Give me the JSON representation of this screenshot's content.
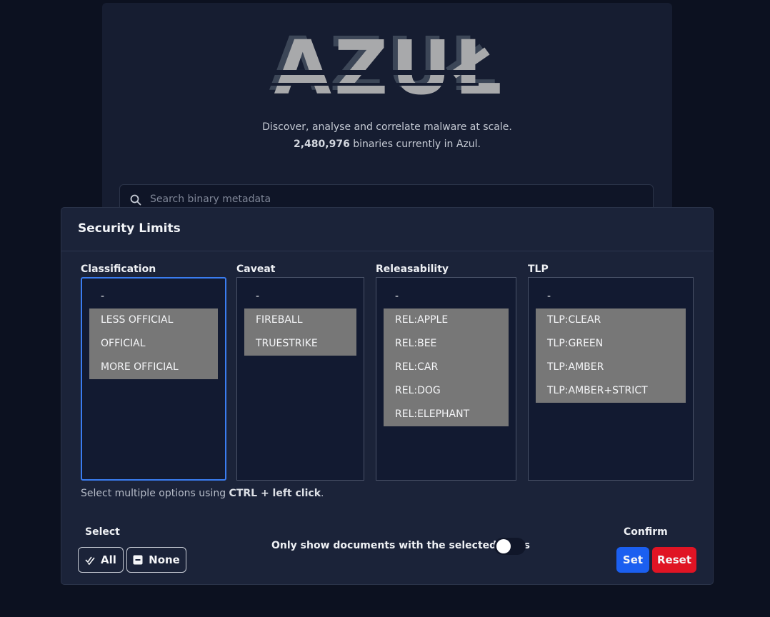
{
  "app": {
    "logo_text": "AZUŁ",
    "tagline": "Discover, analyse and correlate malware at scale.",
    "binary_count": "2,480,976",
    "count_suffix": " binaries currently in Azul.",
    "search_placeholder": "Search binary metadata"
  },
  "modal": {
    "title": "Security Limits",
    "columns": [
      {
        "label": "Classification",
        "options": [
          "-",
          "LESS OFFICIAL",
          "OFFICIAL",
          "MORE OFFICIAL"
        ],
        "selected": [
          false,
          true,
          true,
          true
        ]
      },
      {
        "label": "Caveat",
        "options": [
          "-",
          "FIREBALL",
          "TRUESTRIKE"
        ],
        "selected": [
          false,
          true,
          true
        ]
      },
      {
        "label": "Releasability",
        "options": [
          "-",
          "REL:APPLE",
          "REL:BEE",
          "REL:CAR",
          "REL:DOG",
          "REL:ELEPHANT"
        ],
        "selected": [
          false,
          true,
          true,
          true,
          true,
          true
        ]
      },
      {
        "label": "TLP",
        "options": [
          "-",
          "TLP:CLEAR",
          "TLP:GREEN",
          "TLP:AMBER",
          "TLP:AMBER+STRICT"
        ],
        "selected": [
          false,
          true,
          true,
          true,
          true
        ]
      }
    ],
    "hint_prefix": "Select multiple options using ",
    "hint_key": "CTRL + left click",
    "hint_suffix": ".",
    "select_group_label": "Select",
    "all_label": "All",
    "none_label": "None",
    "toggle_label": "Only show documents with the selected REL's",
    "toggle_on": false,
    "confirm_group_label": "Confirm",
    "set_label": "Set",
    "reset_label": "Reset"
  },
  "colors": {
    "background": "#0c1120",
    "modal": "#1b2339",
    "selected_option": "#777777",
    "focus_border": "#3a7cf0",
    "set_button": "#1b5ff0",
    "reset_button": "#e01424"
  }
}
